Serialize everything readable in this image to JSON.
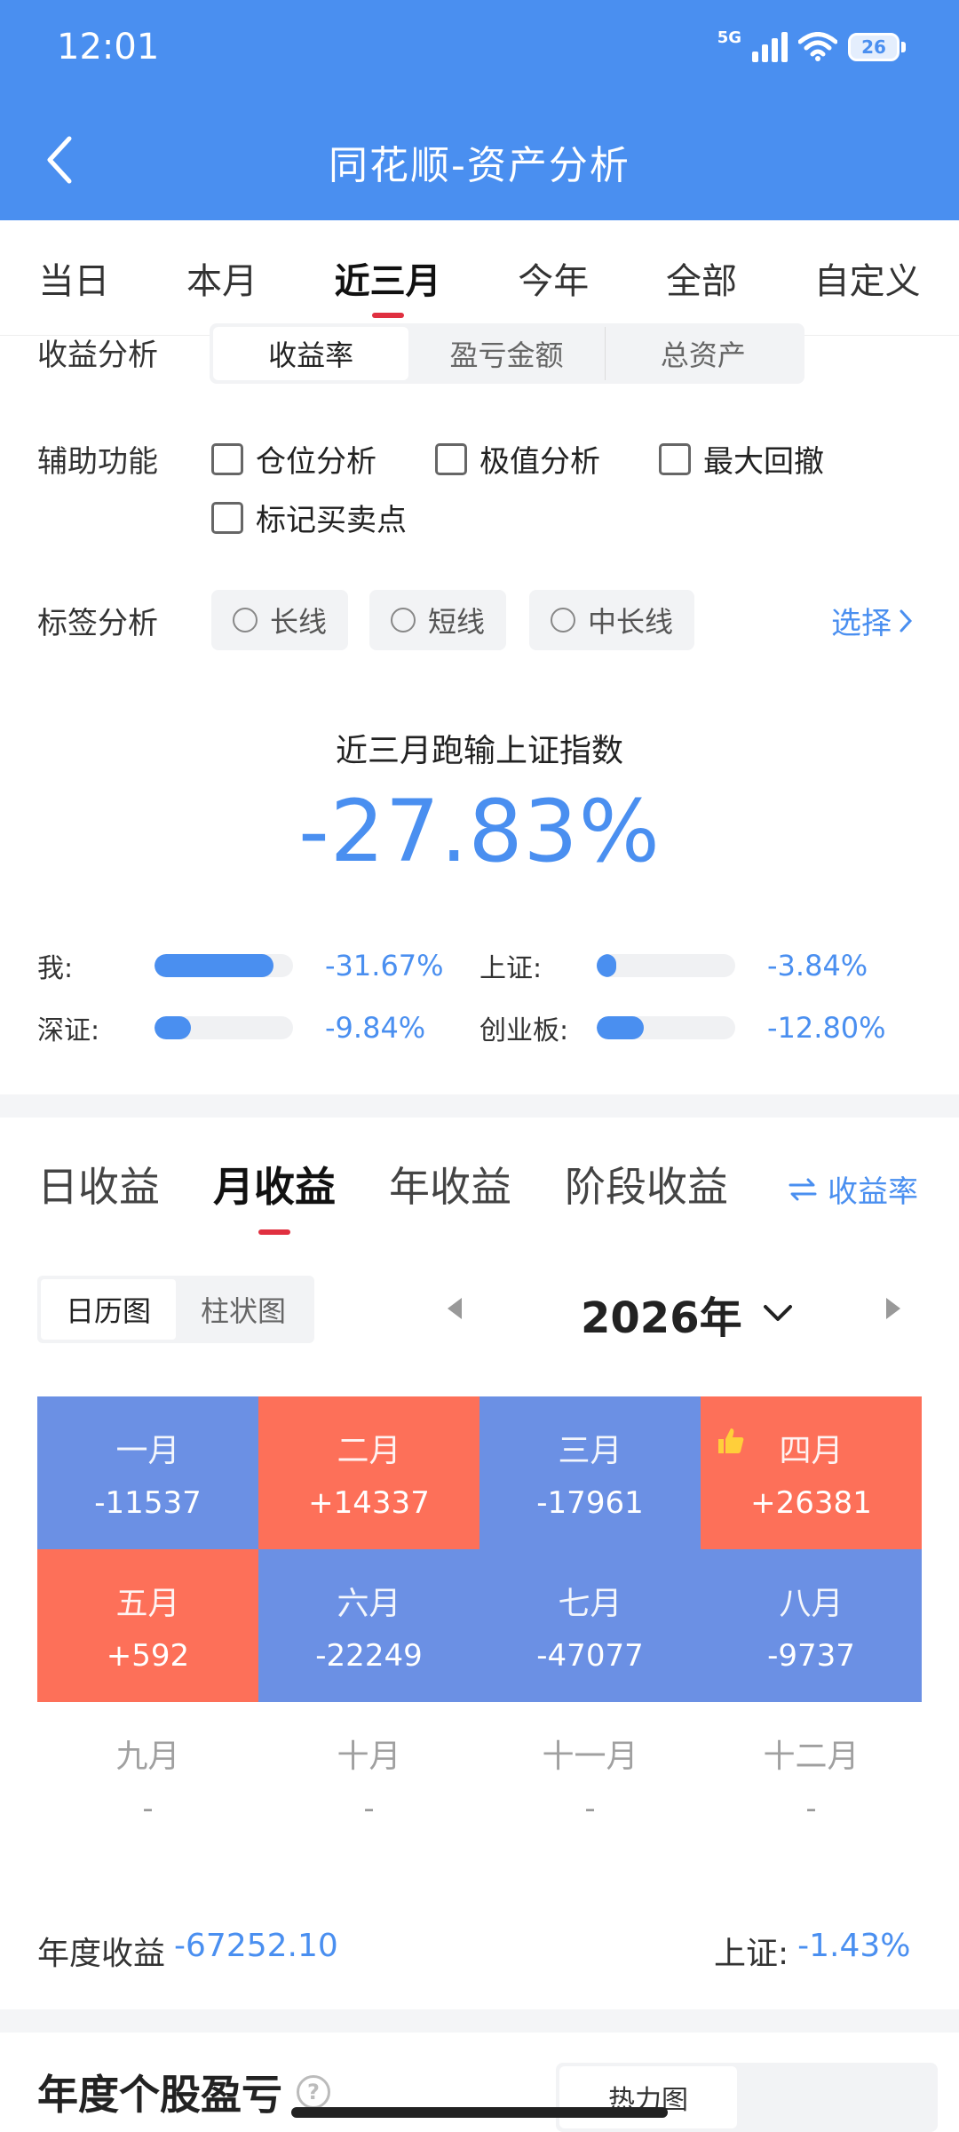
{
  "status_bar": {
    "time": "12:01",
    "network": "5G",
    "battery": "26"
  },
  "header": {
    "title": "同花顺-资产分析"
  },
  "time_tabs": [
    {
      "label": "当日",
      "active": false
    },
    {
      "label": "本月",
      "active": false
    },
    {
      "label": "近三月",
      "active": true
    },
    {
      "label": "今年",
      "active": false
    },
    {
      "label": "全部",
      "active": false
    },
    {
      "label": "自定义",
      "active": false
    }
  ],
  "profit_analysis": {
    "label": "收益分析",
    "options": [
      {
        "label": "收益率",
        "active": true
      },
      {
        "label": "盈亏金额",
        "active": false
      },
      {
        "label": "总资产",
        "active": false
      }
    ]
  },
  "aux": {
    "label": "辅助功能",
    "options": [
      "仓位分析",
      "极值分析",
      "最大回撤",
      "标记买卖点"
    ]
  },
  "tags": {
    "label": "标签分析",
    "options": [
      "长线",
      "短线",
      "中长线"
    ],
    "select": "选择"
  },
  "comparison": {
    "heading": "近三月跑输上证指数",
    "value": "-27.83%",
    "items": [
      {
        "label": "我:",
        "value": "-31.67%",
        "fill": 0.86
      },
      {
        "label": "上证:",
        "value": "-3.84%",
        "fill": 0.14
      },
      {
        "label": "深证:",
        "value": "-9.84%",
        "fill": 0.26
      },
      {
        "label": "创业板:",
        "value": "-12.80%",
        "fill": 0.34
      }
    ]
  },
  "earnings_tabs": [
    {
      "label": "日收益",
      "active": false
    },
    {
      "label": "月收益",
      "active": true
    },
    {
      "label": "年收益",
      "active": false
    },
    {
      "label": "阶段收益",
      "active": false
    }
  ],
  "rate_toggle": "收益率",
  "view_toggle": [
    {
      "label": "日历图",
      "active": true
    },
    {
      "label": "柱状图",
      "active": false
    }
  ],
  "year": "2026年",
  "months": [
    {
      "name": "一月",
      "value": "-11537",
      "state": "loss"
    },
    {
      "name": "二月",
      "value": "+14337",
      "state": "gain"
    },
    {
      "name": "三月",
      "value": "-17961",
      "state": "loss"
    },
    {
      "name": "四月",
      "value": "+26381",
      "state": "gain",
      "thumb": true
    },
    {
      "name": "五月",
      "value": "+592",
      "state": "gain"
    },
    {
      "name": "六月",
      "value": "-22249",
      "state": "loss"
    },
    {
      "name": "七月",
      "value": "-47077",
      "state": "loss"
    },
    {
      "name": "八月",
      "value": "-9737",
      "state": "loss"
    },
    {
      "name": "九月",
      "value": "-",
      "state": "empty"
    },
    {
      "name": "十月",
      "value": "-",
      "state": "empty"
    },
    {
      "name": "十一月",
      "value": "-",
      "state": "empty"
    },
    {
      "name": "十二月",
      "value": "-",
      "state": "empty"
    }
  ],
  "annual": {
    "label": "年度收益",
    "value": "-67252.10",
    "index_label": "上证:",
    "index_value": "-1.43%"
  },
  "next_section": {
    "title": "年度个股盈亏",
    "toggle": "热力图"
  },
  "colors": {
    "accent": "#4a8ff0",
    "loss": "#6b90e4",
    "gain": "#fd7059",
    "tab_indicator": "#e03040"
  }
}
